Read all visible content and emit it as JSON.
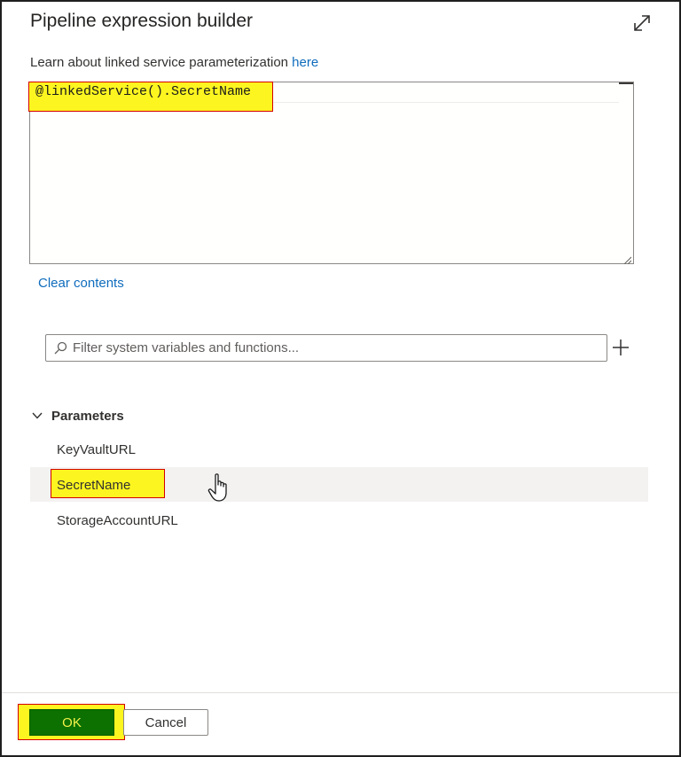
{
  "dialog": {
    "title": "Pipeline expression builder",
    "learn_text": "Learn about linked service parameterization ",
    "learn_link": "here"
  },
  "editor": {
    "expression": "@linkedService().SecretName"
  },
  "clear_label": "Clear contents",
  "filter": {
    "placeholder": "Filter system variables and functions..."
  },
  "parameters": {
    "section_label": "Parameters",
    "items": [
      {
        "label": "KeyVaultURL"
      },
      {
        "label": "SecretName"
      },
      {
        "label": "StorageAccountURL"
      }
    ]
  },
  "footer": {
    "ok_label": "OK",
    "cancel_label": "Cancel"
  },
  "colors": {
    "link": "#0f6cbd",
    "highlight": "#fdf51f",
    "highlight_border": "#d40000",
    "ok_button": "#0c7100"
  },
  "icons": {
    "expand": "expand-icon",
    "search": "search-icon",
    "add": "plus-icon",
    "collapse": "chevron-down-icon",
    "cursor": "hand-cursor-icon"
  }
}
